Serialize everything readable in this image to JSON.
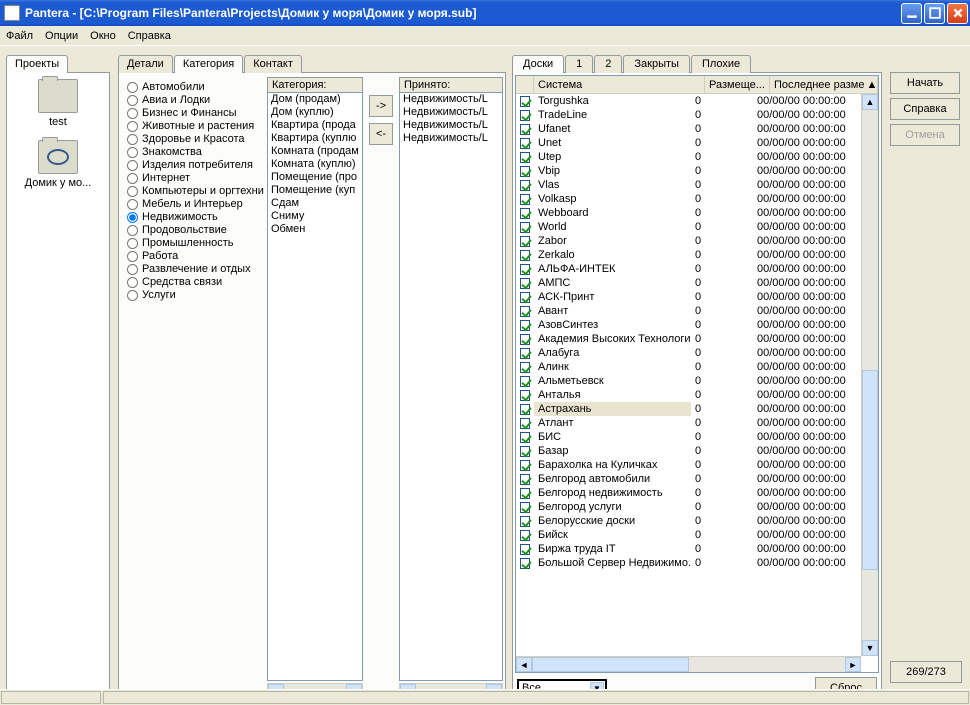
{
  "window": {
    "title": "Pantera    - [C:\\Program Files\\Pantera\\Projects\\Домик у моря\\Домик у моря.sub]"
  },
  "menu": [
    "Файл",
    "Опции",
    "Окно",
    "Справка"
  ],
  "projects": {
    "tab": "Проекты",
    "items": [
      {
        "label": "test",
        "eye": false
      },
      {
        "label": "Домик у мо...",
        "eye": true
      }
    ]
  },
  "mid": {
    "tabs": [
      "Детали",
      "Категория",
      "Контакт"
    ],
    "active": 1,
    "radios": [
      "Автомобили",
      "Авиа и Лодки",
      "Бизнес и Финансы",
      "Животные и растения",
      "Здоровье и Красота",
      "Знакомства",
      "Изделия потребителя",
      "Интернет",
      "Компьютеры и оргтехни",
      "Мебель и Интерьер",
      "Недвижимость",
      "Продовольствие",
      "Промышленность",
      "Работа",
      "Развлечение и отдых",
      "Средства связи",
      "Услуги"
    ],
    "selected_radio": 10,
    "categories_label": "Категория:",
    "categories_items": [
      "Дом (продам)",
      "Дом (куплю)",
      "Квартира (прода",
      "Квартира (куплю",
      "Комната (продам",
      "Комната (куплю)",
      "Помещение (про",
      "Помещение (куп",
      "Сдам",
      "Сниму",
      "Обмен"
    ],
    "accepted_label": "Принято:",
    "accepted_items": [
      "Недвижимость/L",
      "Недвижимость/L",
      "Недвижимость/L",
      "Недвижимость/L"
    ]
  },
  "right": {
    "tabs": [
      "Доски",
      "1",
      "2",
      "Закрыты",
      "Плохие"
    ],
    "active": 0,
    "headers": [
      "",
      "Система",
      "Размеще...",
      "Последнее разме"
    ],
    "rows": [
      {
        "c": true,
        "sys": "Torgushka",
        "n": "0",
        "t": "00/00/00 00:00:00"
      },
      {
        "c": true,
        "sys": "TradeLine",
        "n": "0",
        "t": "00/00/00 00:00:00"
      },
      {
        "c": true,
        "sys": "Ufanet",
        "n": "0",
        "t": "00/00/00 00:00:00"
      },
      {
        "c": true,
        "sys": "Unet",
        "n": "0",
        "t": "00/00/00 00:00:00"
      },
      {
        "c": true,
        "sys": "Utep",
        "n": "0",
        "t": "00/00/00 00:00:00"
      },
      {
        "c": true,
        "sys": "Vbip",
        "n": "0",
        "t": "00/00/00 00:00:00"
      },
      {
        "c": true,
        "sys": "Vlas",
        "n": "0",
        "t": "00/00/00 00:00:00"
      },
      {
        "c": true,
        "sys": "Volkasp",
        "n": "0",
        "t": "00/00/00 00:00:00"
      },
      {
        "c": true,
        "sys": "Webboard",
        "n": "0",
        "t": "00/00/00 00:00:00"
      },
      {
        "c": true,
        "sys": "World",
        "n": "0",
        "t": "00/00/00 00:00:00"
      },
      {
        "c": true,
        "sys": "Zabor",
        "n": "0",
        "t": "00/00/00 00:00:00"
      },
      {
        "c": true,
        "sys": "Zerkalo",
        "n": "0",
        "t": "00/00/00 00:00:00"
      },
      {
        "c": true,
        "sys": "АЛЬФА-ИНТЕК",
        "n": "0",
        "t": "00/00/00 00:00:00"
      },
      {
        "c": true,
        "sys": "АМПС",
        "n": "0",
        "t": "00/00/00 00:00:00"
      },
      {
        "c": true,
        "sys": "АСК-Принт",
        "n": "0",
        "t": "00/00/00 00:00:00"
      },
      {
        "c": true,
        "sys": "Авант",
        "n": "0",
        "t": "00/00/00 00:00:00"
      },
      {
        "c": true,
        "sys": "АзовСинтез",
        "n": "0",
        "t": "00/00/00 00:00:00"
      },
      {
        "c": true,
        "sys": "Академия Высоких Технологий",
        "n": "0",
        "t": "00/00/00 00:00:00"
      },
      {
        "c": true,
        "sys": "Алабуга",
        "n": "0",
        "t": "00/00/00 00:00:00"
      },
      {
        "c": true,
        "sys": "Алинк",
        "n": "0",
        "t": "00/00/00 00:00:00"
      },
      {
        "c": true,
        "sys": "Альметьевск",
        "n": "0",
        "t": "00/00/00 00:00:00"
      },
      {
        "c": true,
        "sys": "Анталья",
        "n": "0",
        "t": "00/00/00 00:00:00"
      },
      {
        "c": true,
        "sys": "Астрахань",
        "n": "0",
        "t": "00/00/00 00:00:00",
        "hl": true
      },
      {
        "c": true,
        "sys": "Атлант",
        "n": "0",
        "t": "00/00/00 00:00:00"
      },
      {
        "c": true,
        "sys": "БИС",
        "n": "0",
        "t": "00/00/00 00:00:00"
      },
      {
        "c": true,
        "sys": "Базар",
        "n": "0",
        "t": "00/00/00 00:00:00"
      },
      {
        "c": true,
        "sys": "Барахолка на Куличках",
        "n": "0",
        "t": "00/00/00 00:00:00"
      },
      {
        "c": true,
        "sys": "Белгород автомобили",
        "n": "0",
        "t": "00/00/00 00:00:00"
      },
      {
        "c": true,
        "sys": "Белгород недвижимость",
        "n": "0",
        "t": "00/00/00 00:00:00"
      },
      {
        "c": true,
        "sys": "Белгород услуги",
        "n": "0",
        "t": "00/00/00 00:00:00"
      },
      {
        "c": true,
        "sys": "Белорусские доски",
        "n": "0",
        "t": "00/00/00 00:00:00"
      },
      {
        "c": true,
        "sys": "Бийск",
        "n": "0",
        "t": "00/00/00 00:00:00"
      },
      {
        "c": true,
        "sys": "Биржа труда IT",
        "n": "0",
        "t": "00/00/00 00:00:00"
      },
      {
        "c": true,
        "sys": "Большой Сервер Недвижимо...",
        "n": "0",
        "t": "00/00/00 00:00:00"
      }
    ],
    "filter_value": "Все",
    "reset_label": "Сброс"
  },
  "actions": {
    "start": "Начать",
    "help": "Справка",
    "cancel": "Отмена"
  },
  "counter": "269/273"
}
